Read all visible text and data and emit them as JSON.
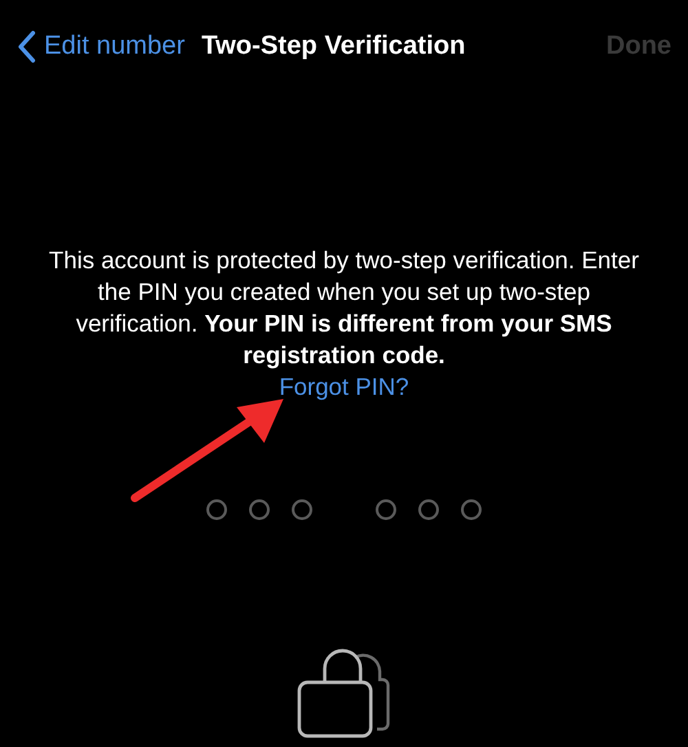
{
  "nav_bar": {
    "back_label": "Edit number",
    "title": "Two-Step Verification",
    "done": {
      "label": "Done",
      "disabled": true
    }
  },
  "message": "This account is protected by two-step verification. Enter the PIN you created when you set up two-step verification. **Your PIN is different from your SMS registration code.**",
  "forgot_link": "Forgot PIN?",
  "pin_digits": [
    {
      "filled": false
    },
    {
      "filled": false
    },
    {
      "filled": false
    },
    {
      "filled": false
    },
    {
      "filled": false
    },
    {
      "filled": false
    }
  ]
}
